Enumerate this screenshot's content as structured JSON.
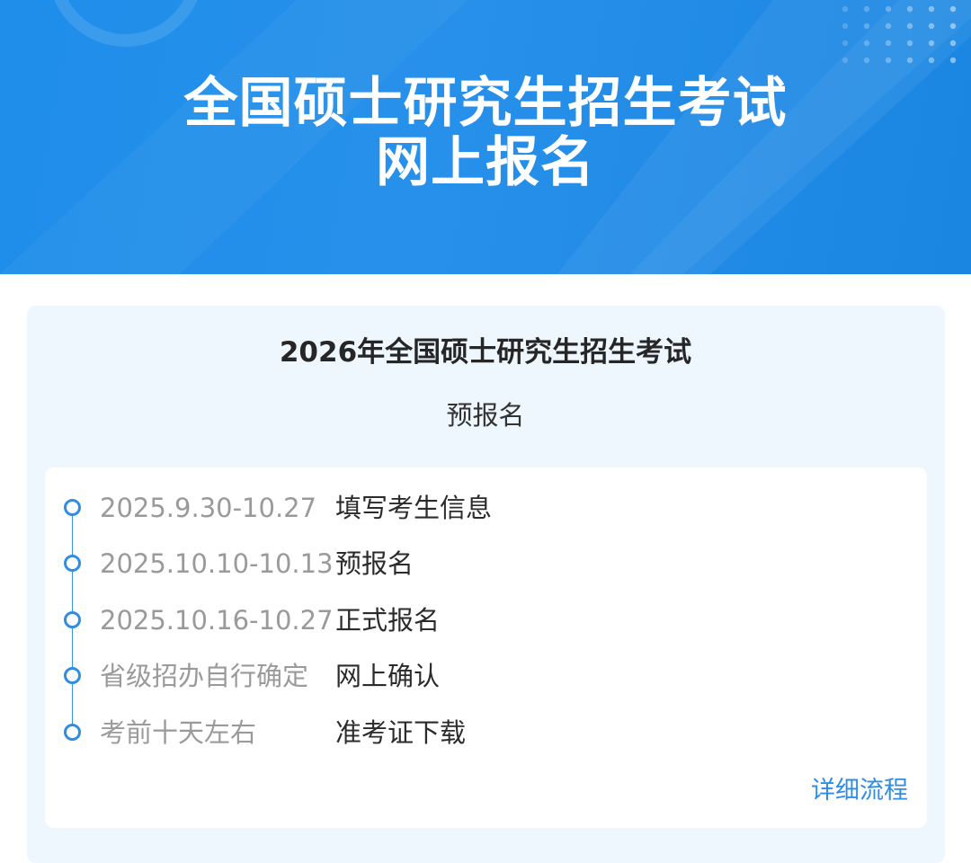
{
  "header": {
    "title_line1": "全国硕士研究生招生考试",
    "title_line2": "网上报名"
  },
  "panel": {
    "title": "2026年全国硕士研究生招生考试",
    "subtitle": "预报名"
  },
  "timeline": [
    {
      "date": "2025.9.30-10.27",
      "event": "填写考生信息"
    },
    {
      "date": "2025.10.10-10.13",
      "event": "预报名"
    },
    {
      "date": "2025.10.16-10.27",
      "event": "正式报名"
    },
    {
      "date": "省级招办自行确定",
      "event": "网上确认"
    },
    {
      "date": "考前十天左右",
      "event": "准考证下载"
    }
  ],
  "detail_link": "详细流程",
  "colors": {
    "banner": "#1e8eea",
    "accent": "#2f8de4",
    "panel_bg": "#eef6fe"
  }
}
